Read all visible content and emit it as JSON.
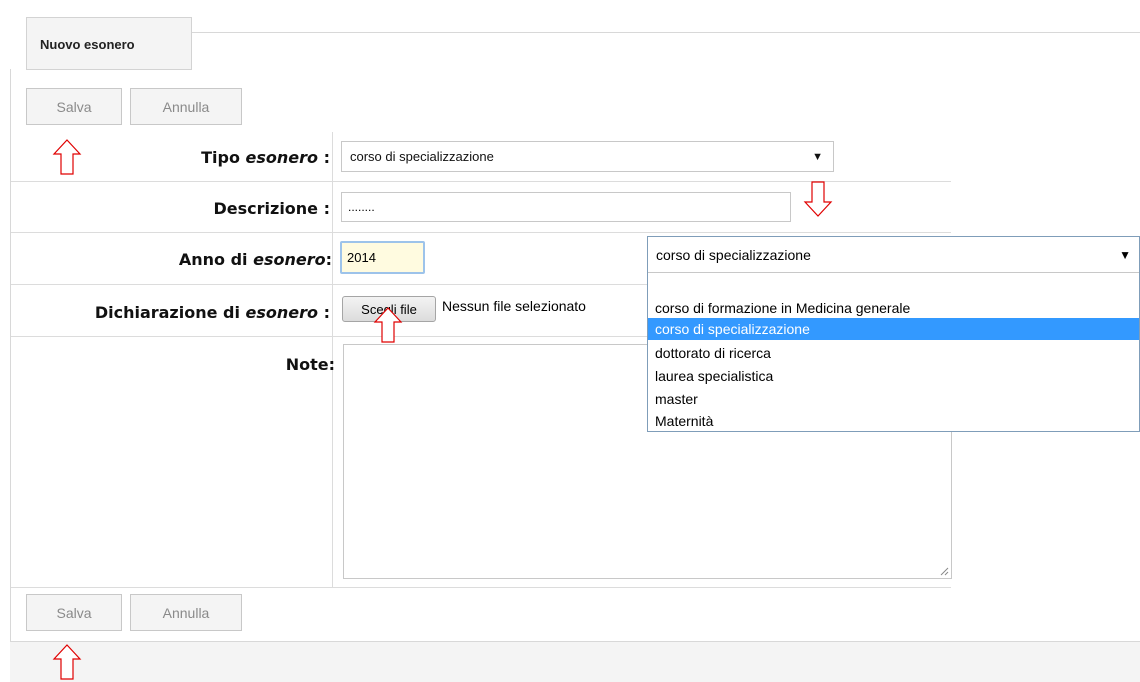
{
  "tab": {
    "title": "Nuovo esonero"
  },
  "toolbar_top": {
    "save_label": "Salva",
    "cancel_label": "Annulla"
  },
  "toolbar_bottom": {
    "save_label": "Salva",
    "cancel_label": "Annulla"
  },
  "form": {
    "tipo": {
      "label_bold": "Tipo ",
      "label_italic": "esonero",
      "label_end": " :",
      "value": "corso di specializzazione"
    },
    "descrizione": {
      "label": "Descrizione :",
      "value": "........"
    },
    "anno": {
      "label_bold": "Anno di ",
      "label_italic": "esonero",
      "label_end": ":",
      "value": "2014"
    },
    "dichiarazione": {
      "label_bold": "Dichiarazione di ",
      "label_italic": "esonero",
      "label_end": " :",
      "button": "Scegli file",
      "status": "Nessun file selezionato"
    },
    "note": {
      "label": "Note:",
      "value": ""
    }
  },
  "dropdown": {
    "selected": "corso di specializzazione",
    "options": [
      "",
      "corso di formazione in Medicina generale",
      "corso di specializzazione",
      "dottorato di ricerca",
      "laurea specialistica",
      "master",
      "Maternità"
    ],
    "selected_index": 2
  },
  "colors": {
    "annotation_arrow": "#e00000",
    "selection": "#3399ff",
    "focus_border": "#9dc3ea"
  }
}
